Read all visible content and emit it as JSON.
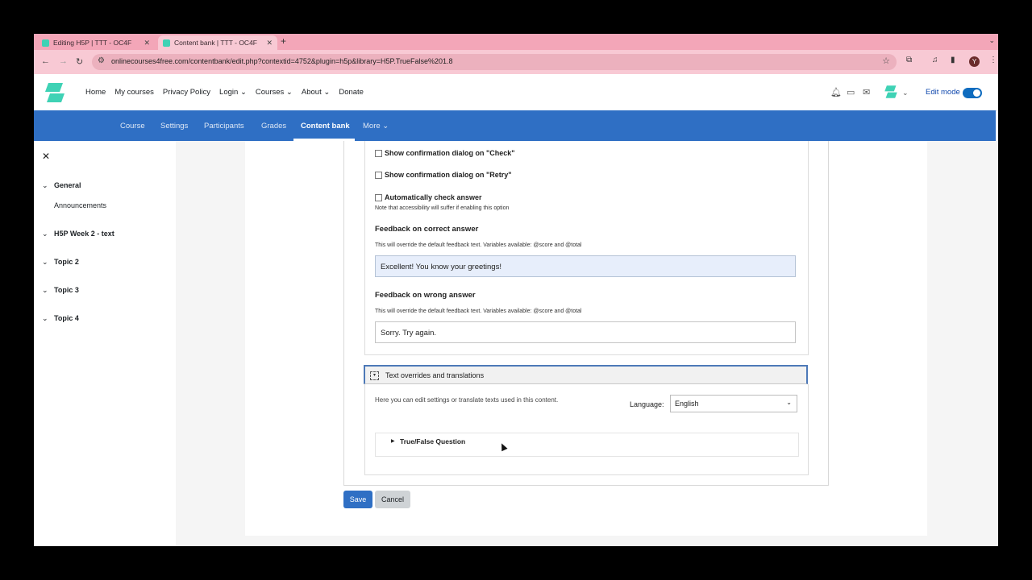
{
  "browser": {
    "tabs": [
      {
        "title": "Editing H5P | TTT - OC4F",
        "active": false
      },
      {
        "title": "Content bank | TTT - OC4F",
        "active": true
      }
    ],
    "url": "onlinecourses4free.com/contentbank/edit.php?contextid=4752&plugin=h5p&library=H5P.TrueFalse%201.8",
    "profile_initial": "Y"
  },
  "site_nav": {
    "items": [
      "Home",
      "My courses",
      "Privacy Policy",
      "Login",
      "Courses",
      "About",
      "Donate"
    ],
    "edit_mode_label": "Edit mode",
    "edit_mode_on": true
  },
  "course_nav": {
    "items": [
      "Course",
      "Settings",
      "Participants",
      "Grades",
      "Content bank",
      "More"
    ],
    "active": "Content bank"
  },
  "drawer": {
    "sections": [
      {
        "title": "General",
        "children": [
          "Announcements"
        ]
      },
      {
        "title": "H5P Week 2 - text",
        "children": []
      },
      {
        "title": "Topic 2",
        "children": []
      },
      {
        "title": "Topic 3",
        "children": []
      },
      {
        "title": "Topic 4",
        "children": []
      }
    ]
  },
  "editor": {
    "checkboxes": [
      {
        "label": "Show confirmation dialog on \"Check\"",
        "checked": false
      },
      {
        "label": "Show confirmation dialog on \"Retry\"",
        "checked": false
      },
      {
        "label": "Automatically check answer",
        "checked": false
      }
    ],
    "auto_check_note": "Note that accessibility will suffer if enabling this option",
    "feedback_correct": {
      "label": "Feedback on correct answer",
      "description": "This will override the default feedback text. Variables available: @score and @total",
      "value": "Excellent! You know your greetings!"
    },
    "feedback_wrong": {
      "label": "Feedback on wrong answer",
      "description": "This will override the default feedback text. Variables available: @score and @total",
      "value": "Sorry. Try again."
    },
    "overrides": {
      "title": "Text overrides and translations",
      "description": "Here you can edit settings or translate texts used in this content.",
      "language_label": "Language:",
      "language_value": "English",
      "group_label": "True/False Question"
    }
  },
  "actions": {
    "save": "Save",
    "cancel": "Cancel"
  },
  "colors": {
    "tab_strip": "#f3a6b8",
    "course_nav": "#2f6fc4",
    "primary_button": "#2f6fc4"
  }
}
